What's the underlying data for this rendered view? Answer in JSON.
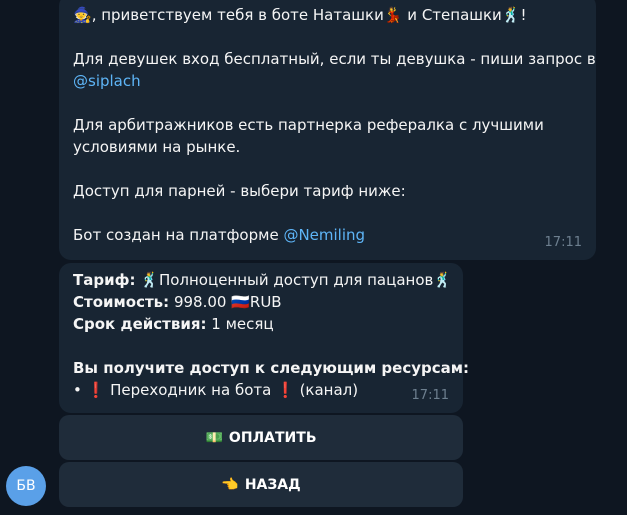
{
  "message1": {
    "emoji_start": "🧙",
    "greeting_1": ", приветствуем тебя в боте Наташки",
    "emoji_dancer": "💃",
    "greeting_2": " и Степашки",
    "emoji_man_dancer": "🕺",
    "greeting_3": "!",
    "line2": "Для девушек вход бесплатный, если ты девушка - пиши запрос в",
    "link1": "@siplach",
    "line3a": "Для арбитражников есть партнерка рефералка с лучшими",
    "line3b": "условиями на рынке.",
    "line4": "Доступ для парней - выбери тариф ниже:",
    "line5": "Бот создан на платформе ",
    "link2": "@Nemiling",
    "time": "17:11"
  },
  "message2": {
    "tariff_label": "Тариф:",
    "tariff_emoji": "🕺",
    "tariff_value": "Полноценный доступ для пацанов",
    "tariff_emoji_end": "🕺",
    "cost_label": "Стоимость:",
    "cost_value": "998.00",
    "cost_flag": "🇷🇺",
    "cost_currency": "RUB",
    "term_label": "Срок действия:",
    "term_value": "1 месяц",
    "resources_label": "Вы получите доступ к следующим ресурсам:",
    "bullet": "•",
    "excl1": "❗",
    "resource_name": "Переходник на бота",
    "excl2": "❗",
    "resource_type": "(канал)",
    "time": "17:11"
  },
  "buttons": {
    "pay_icon": "💵",
    "pay_label": "ОПЛАТИТЬ",
    "back_icon": "👈",
    "back_label": "НАЗАД"
  },
  "avatar": {
    "initials": "БВ",
    "color": "#5aa0e8"
  }
}
